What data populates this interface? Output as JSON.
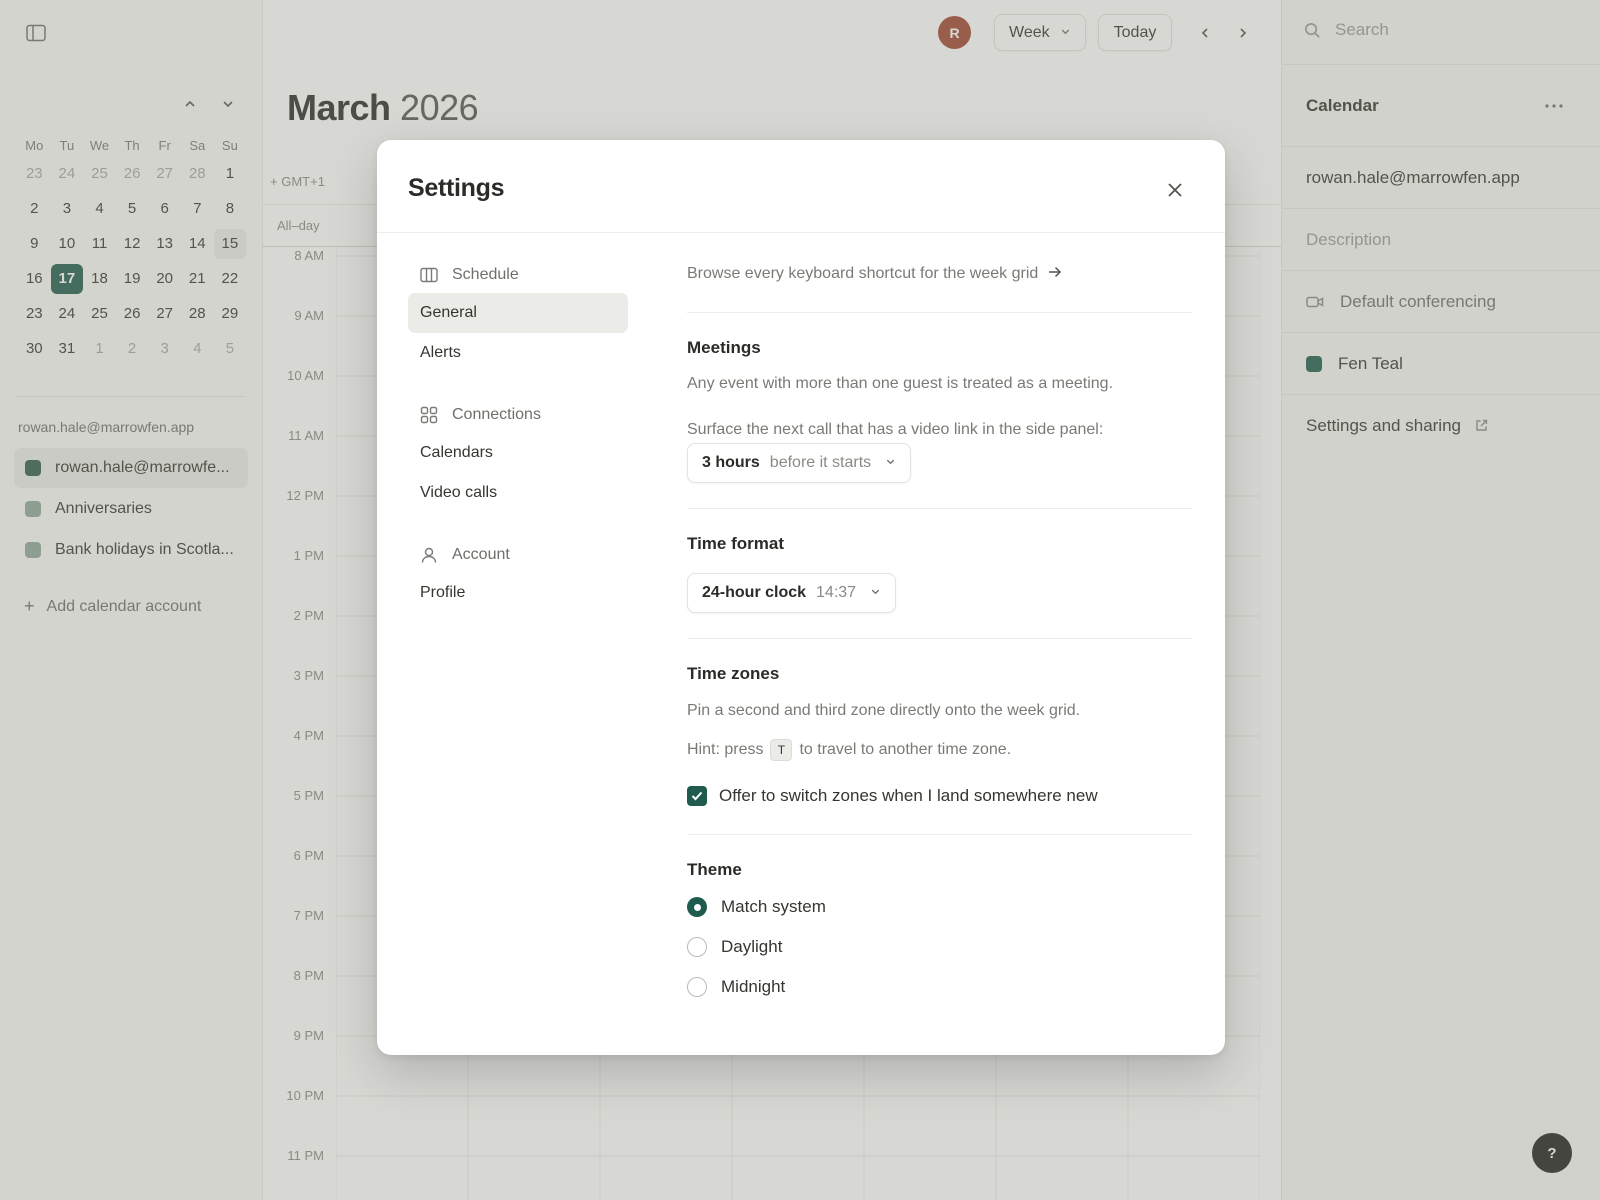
{
  "header": {
    "avatar_initial": "R",
    "view_label": "Week",
    "today_label": "Today",
    "month": "March",
    "year": "2026"
  },
  "mini_calendar": {
    "weekdays": [
      "Mo",
      "Tu",
      "We",
      "Th",
      "Fr",
      "Sa",
      "Su"
    ],
    "weeks": [
      [
        "23",
        "24",
        "25",
        "26",
        "27",
        "28",
        "1"
      ],
      [
        "2",
        "3",
        "4",
        "5",
        "6",
        "7",
        "8"
      ],
      [
        "9",
        "10",
        "11",
        "12",
        "13",
        "14",
        "15"
      ],
      [
        "16",
        "17",
        "18",
        "19",
        "20",
        "21",
        "22"
      ],
      [
        "23",
        "24",
        "25",
        "26",
        "27",
        "28",
        "29"
      ],
      [
        "30",
        "31",
        "1",
        "2",
        "3",
        "4",
        "5"
      ]
    ],
    "today": "17",
    "highlighted": "15"
  },
  "sidebar": {
    "account_label": "rowan.hale@marrowfen.app",
    "calendars": [
      {
        "label": "rowan.hale@marrowfe...",
        "color": "#2e5b4e"
      },
      {
        "label": "Anniversaries",
        "color": "#8fa99a"
      },
      {
        "label": "Bank holidays in Scotla...",
        "color": "#8fa99a"
      }
    ],
    "add_account_label": "Add calendar account"
  },
  "grid": {
    "timezone": "GMT+1",
    "allday_label": "All–day",
    "hours": [
      "8 AM",
      "9 AM",
      "10 AM",
      "11 AM",
      "12 PM",
      "1 PM",
      "2 PM",
      "3 PM",
      "4 PM",
      "5 PM",
      "6 PM",
      "7 PM",
      "8 PM",
      "9 PM",
      "10 PM",
      "11 PM"
    ]
  },
  "right_panel": {
    "search_placeholder": "Search",
    "title": "Calendar",
    "email": "rowan.hale@marrowfen.app",
    "description_placeholder": "Description",
    "conferencing": "Default conferencing",
    "color_name": "Fen Teal",
    "color_hex": "#1f5c4d",
    "sharing_label": "Settings and sharing"
  },
  "help_label": "?",
  "settings": {
    "title": "Settings",
    "nav": {
      "schedule": "Schedule",
      "general": "General",
      "alerts": "Alerts",
      "connections": "Connections",
      "calendars": "Calendars",
      "video_calls": "Video calls",
      "account": "Account",
      "profile": "Profile"
    },
    "shortcuts_link": "Browse every keyboard shortcut for the week grid",
    "meetings": {
      "title": "Meetings",
      "description": "Any event with more than one guest is treated as a meeting.",
      "prompt": "Surface the next call that has a video link in the side panel:",
      "value": "3 hours",
      "suffix": "before it starts"
    },
    "time_format": {
      "title": "Time format",
      "value": "24-hour clock",
      "example": "14:37"
    },
    "time_zones": {
      "title": "Time zones",
      "description": "Pin a second and third zone directly onto the week grid.",
      "hint_prefix": "Hint: press",
      "hint_key": "T",
      "hint_suffix": "to travel to another time zone.",
      "checkbox_label": "Offer to switch zones when I land somewhere new",
      "checkbox_checked": true
    },
    "theme": {
      "title": "Theme",
      "options": [
        "Match system",
        "Daylight",
        "Midnight"
      ],
      "selected": "Match system"
    }
  }
}
